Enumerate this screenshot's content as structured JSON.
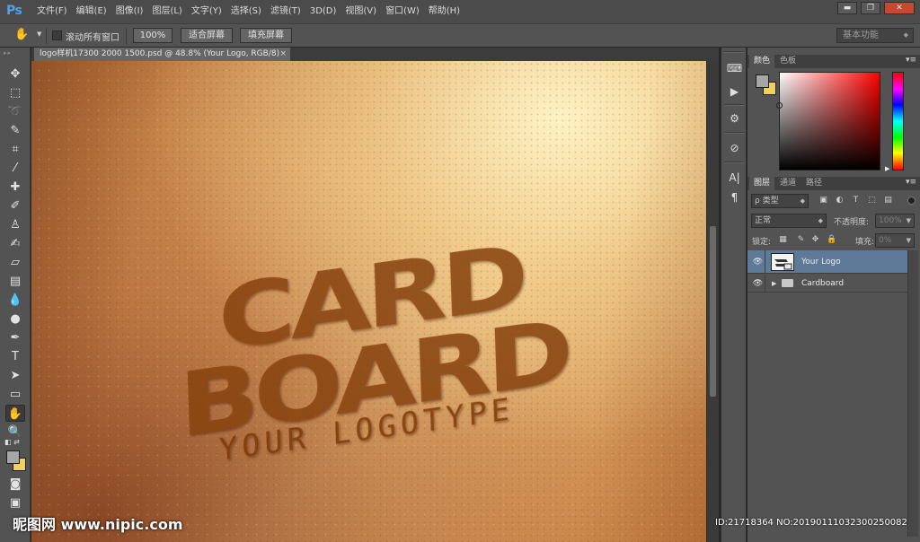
{
  "app": {
    "logo_text": "Ps"
  },
  "menu": [
    "文件(F)",
    "编辑(E)",
    "图像(I)",
    "图层(L)",
    "文字(Y)",
    "选择(S)",
    "滤镜(T)",
    "3D(D)",
    "视图(V)",
    "窗口(W)",
    "帮助(H)"
  ],
  "window_buttons": {
    "minimize": "▬",
    "restore": "❐",
    "close": "✕"
  },
  "options_bar": {
    "scroll_all_label": "滚动所有窗口",
    "zoom_100": "100%",
    "fit_screen": "适合屏幕",
    "fill_screen": "填充屏幕",
    "workspace": "基本功能"
  },
  "document": {
    "tab_title": "logo样机17300 2000 1500.psd @ 48.8% (Your Logo, RGB/8)",
    "close": "×"
  },
  "artwork": {
    "line1": "CARD",
    "line2": "BOARD",
    "tagline": "YOUR LOGOTYPE"
  },
  "color_panel": {
    "tabs": [
      "颜色",
      "色板"
    ],
    "foreground": "#a6a6a6",
    "background": "#f0d060",
    "picked_hue": "#ff0000"
  },
  "layers_panel": {
    "tabs": [
      "图层",
      "通道",
      "路径"
    ],
    "filter_kind": "ρ 类型",
    "blend_mode": "正常",
    "opacity_label": "不透明度:",
    "opacity": "100%",
    "lock_label": "锁定:",
    "fill_label": "填充:",
    "fill": "0%",
    "layers": [
      {
        "name": "Your Logo",
        "type": "smart-object",
        "visible": true,
        "selected": true
      },
      {
        "name": "Cardboard",
        "type": "group",
        "visible": true,
        "selected": false
      }
    ]
  },
  "watermark": {
    "site": "昵图网 www.nipic.com",
    "id_text": "ID:21718364 NO:20190111032300250082"
  }
}
